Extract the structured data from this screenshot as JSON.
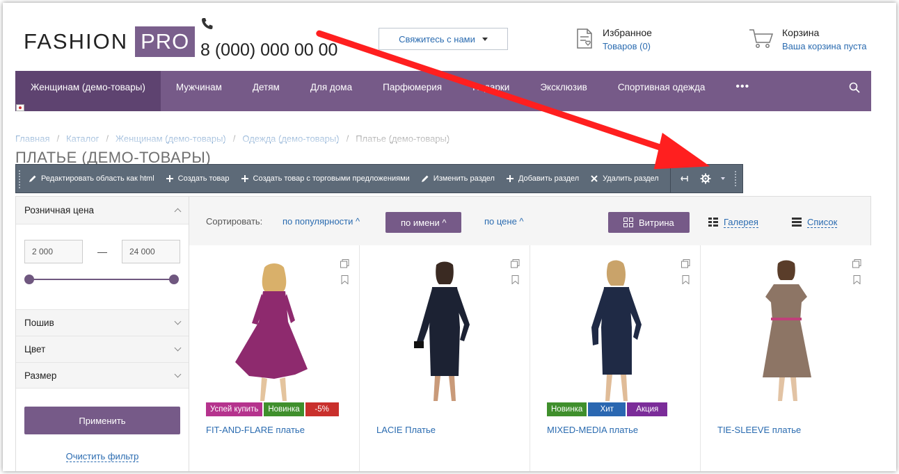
{
  "header": {
    "logo_main": "FASHION",
    "logo_accent": "PRO",
    "phone": "8 (000) 000 00 00",
    "contact_button": "Свяжитесь с нами",
    "favorites_title": "Избранное",
    "favorites_link": "Товаров (0)",
    "cart_title": "Корзина",
    "cart_link": "Ваша корзина пуста"
  },
  "nav": {
    "items": [
      {
        "label": "Женщинам (демо-товары)",
        "active": true
      },
      {
        "label": "Мужчинам"
      },
      {
        "label": "Детям"
      },
      {
        "label": "Для дома"
      },
      {
        "label": "Парфюмерия"
      },
      {
        "label": "Подарки"
      },
      {
        "label": "Эксклюзив"
      },
      {
        "label": "Спортивная одежда"
      }
    ],
    "more": "•••"
  },
  "breadcrumb": {
    "items": [
      "Главная",
      "Каталог",
      "Женщинам (демо-товары)",
      "Одежда (демо-товары)"
    ],
    "separator": "/",
    "current": "Платье (демо-товары)"
  },
  "page_title": "ПЛАТЬЕ (ДЕМО-ТОВАРЫ)",
  "toolbar": {
    "edit_html": "Редактировать область как html",
    "create_product": "Создать товар",
    "create_product_offers": "Создать товар с торговыми предложениями",
    "edit_section": "Изменить раздел",
    "add_section": "Добавить раздел",
    "delete_section": "Удалить раздел"
  },
  "filter": {
    "price_title": "Розничная цена",
    "price_min": "2 000",
    "price_max": "24 000",
    "price_dash": "—",
    "groups": [
      "Пошив",
      "Цвет",
      "Размер"
    ],
    "apply": "Применить",
    "clear": "Очистить фильтр"
  },
  "sort": {
    "label": "Сортировать:",
    "options": [
      {
        "label": "по популярности ^"
      },
      {
        "label": "по имени ^",
        "active": true
      },
      {
        "label": "по цене ^"
      }
    ],
    "views": [
      {
        "label": "Витрина",
        "active": true
      },
      {
        "label": "Галерея"
      },
      {
        "label": "Список"
      }
    ]
  },
  "products": [
    {
      "name": "FIT-AND-FLARE платье",
      "dress_color": "#8e2a6e",
      "badges": [
        {
          "text": "Успей купить",
          "color": "#b5338d"
        },
        {
          "text": "Новинка",
          "color": "#3f8f2c"
        },
        {
          "text": "-5%",
          "color": "#c9302c"
        }
      ]
    },
    {
      "name": "LACIE Платье",
      "dress_color": "#1c2233",
      "badges": []
    },
    {
      "name": "MIXED-MEDIA платье",
      "dress_color": "#1f2a45",
      "badges": [
        {
          "text": "Новинка",
          "color": "#3f8f2c"
        },
        {
          "text": "Хит",
          "color": "#2a67b1"
        },
        {
          "text": "Акция",
          "color": "#7b2c99"
        }
      ]
    },
    {
      "name": "TIE-SLEEVE платье",
      "dress_color": "#8d7565",
      "badges": []
    }
  ],
  "colors": {
    "brand": "#765a88",
    "link": "#2a6bb0",
    "toolbar": "#5d6a78",
    "arrow": "#ff1f1f"
  }
}
